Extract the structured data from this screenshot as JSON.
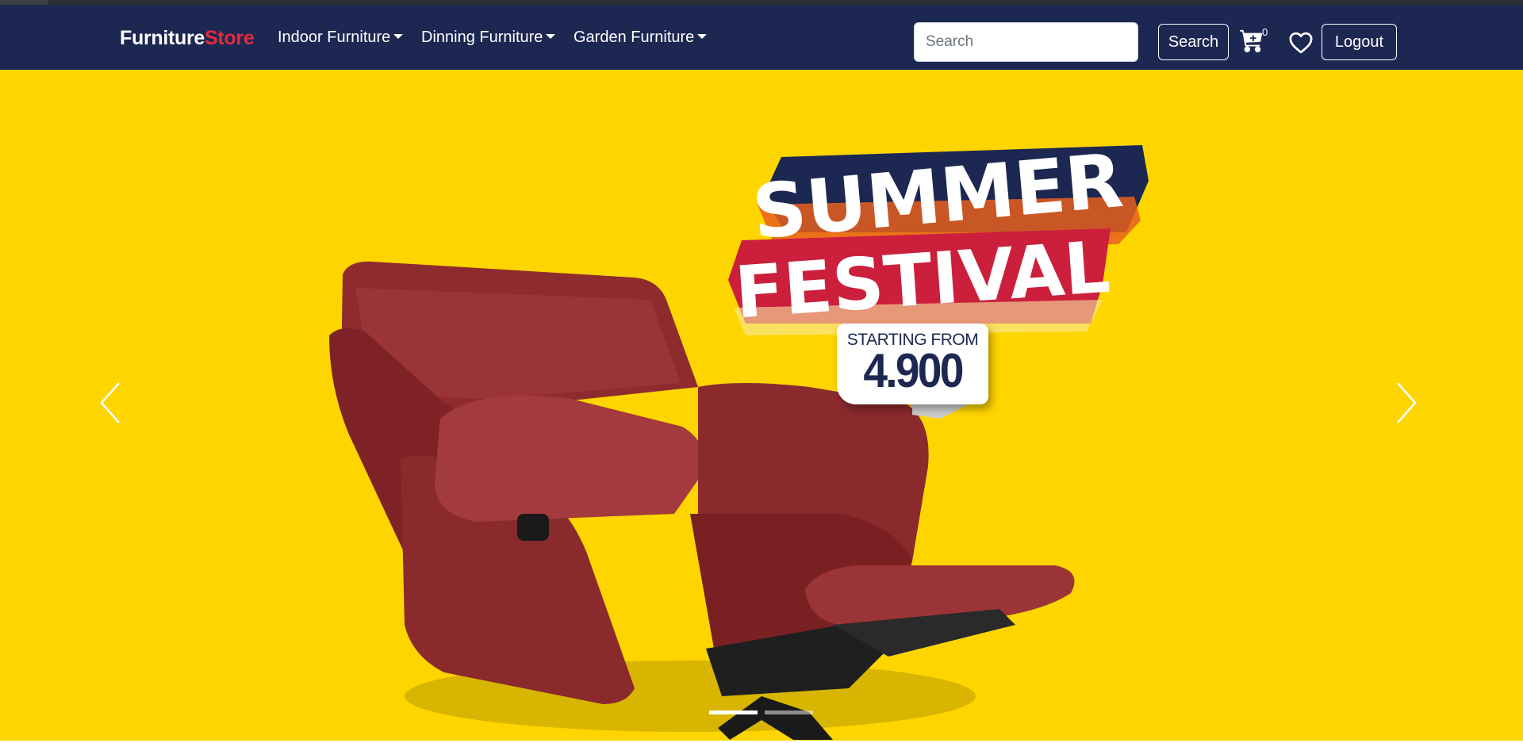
{
  "brand": {
    "part1": "Furniture",
    "part2": "Store"
  },
  "nav": {
    "menus": [
      {
        "label": "Indoor Furniture"
      },
      {
        "label": "Dinning Furniture"
      },
      {
        "label": "Garden Furniture"
      }
    ],
    "search": {
      "placeholder": "Search",
      "value": ""
    },
    "search_button": "Search",
    "cart_count": "0",
    "logout_button": "Logout"
  },
  "banner": {
    "headline1": "SUMMER",
    "headline2": "FESTIVAL",
    "price_label": "STARTING FROM",
    "price_value": "4.900",
    "active_slide": 1,
    "slide_count": 2
  },
  "icons": [
    "cart-icon",
    "heart-icon",
    "chevron-left-icon",
    "chevron-right-icon"
  ],
  "colors": {
    "navbar": "#1c2752",
    "brand_accent": "#e32b3b",
    "banner_bg": "#ffd500",
    "headline_red": "#cc1f3c",
    "headline_navy": "#1c2752",
    "chair": "#8e2b2e"
  }
}
